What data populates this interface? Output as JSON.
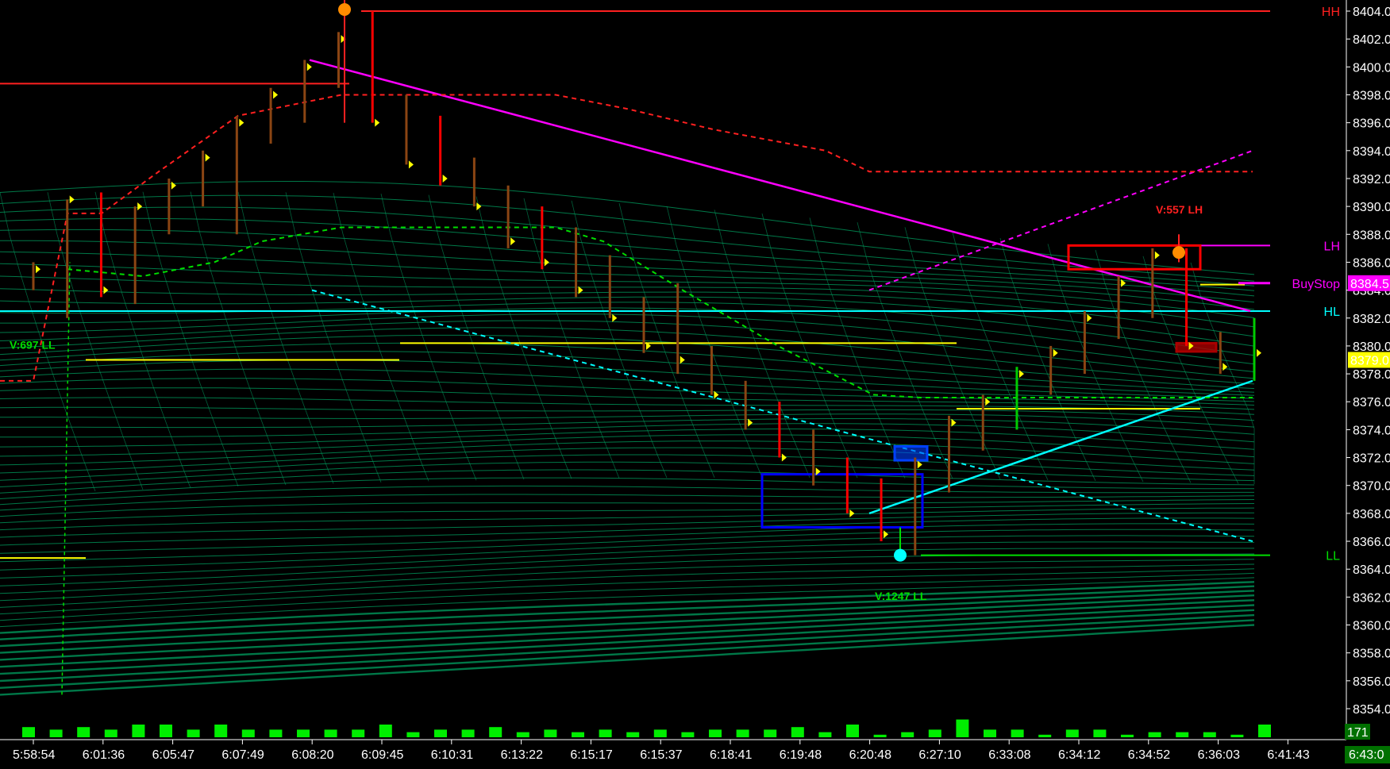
{
  "chart_data": {
    "type": "candlestick",
    "ylim": [
      8352,
      8405
    ],
    "y_ticks": [
      8404,
      8402,
      8400,
      8398,
      8396,
      8394,
      8392,
      8390,
      8388,
      8386,
      8384,
      8382,
      8380,
      8378,
      8376,
      8374,
      8372,
      8370,
      8368,
      8366,
      8364,
      8362,
      8360,
      8358,
      8356,
      8354
    ],
    "y_tick_labels": [
      "8404.0",
      "8402.0",
      "8400.0",
      "8398.0",
      "8396.0",
      "8394.0",
      "8392.0",
      "8390.0",
      "8388.0",
      "8386.0",
      "8384.0",
      "8382.0",
      "8380.0",
      "8378.0",
      "8376.0",
      "8374.0",
      "8372.0",
      "8370.0",
      "8368.0",
      "8366.0",
      "8364.0",
      "8362.0",
      "8360.0",
      "8358.0",
      "8356.0",
      "8354.0"
    ],
    "x_tick_labels": [
      "5:58:54",
      "6:01:36",
      "6:05:47",
      "6:07:49",
      "6:08:20",
      "6:09:45",
      "6:10:31",
      "6:13:22",
      "6:15:17",
      "6:15:37",
      "6:18:41",
      "6:19:48",
      "6:20:48",
      "6:27:10",
      "6:33:08",
      "6:34:12",
      "6:34:52",
      "6:36:03",
      "6:41:43"
    ],
    "bars": [
      {
        "o": 8385,
        "h": 8386,
        "l": 8384,
        "c": 8385.5,
        "color": "#8b4513"
      },
      {
        "o": 8387,
        "h": 8390.5,
        "l": 8382,
        "c": 8390.5,
        "color": "#8b4513"
      },
      {
        "o": 8388,
        "h": 8391,
        "l": 8383.5,
        "c": 8384,
        "color": "#ff0000"
      },
      {
        "o": 8386,
        "h": 8390,
        "l": 8383,
        "c": 8390,
        "color": "#8b4513"
      },
      {
        "o": 8388.5,
        "h": 8392,
        "l": 8388,
        "c": 8391.5,
        "color": "#8b4513"
      },
      {
        "o": 8391,
        "h": 8394,
        "l": 8390,
        "c": 8393.5,
        "color": "#8b4513"
      },
      {
        "o": 8392,
        "h": 8396.5,
        "l": 8388,
        "c": 8396,
        "color": "#8b4513"
      },
      {
        "o": 8395,
        "h": 8398.5,
        "l": 8394.5,
        "c": 8398,
        "color": "#8b4513"
      },
      {
        "o": 8397,
        "h": 8400.5,
        "l": 8396,
        "c": 8400,
        "color": "#8b4513"
      },
      {
        "o": 8399,
        "h": 8402.5,
        "l": 8398.5,
        "c": 8402,
        "color": "#8b4513"
      },
      {
        "o": 8400,
        "h": 8404,
        "l": 8396,
        "c": 8396,
        "color": "#ff0000"
      },
      {
        "o": 8397,
        "h": 8398,
        "l": 8393,
        "c": 8393,
        "color": "#8b4513"
      },
      {
        "o": 8396,
        "h": 8396.5,
        "l": 8391.5,
        "c": 8392,
        "color": "#ff0000"
      },
      {
        "o": 8393,
        "h": 8393.5,
        "l": 8390,
        "c": 8390,
        "color": "#8b4513"
      },
      {
        "o": 8390,
        "h": 8391.5,
        "l": 8387,
        "c": 8387.5,
        "color": "#8b4513"
      },
      {
        "o": 8390,
        "h": 8390,
        "l": 8385.5,
        "c": 8386,
        "color": "#ff0000"
      },
      {
        "o": 8388,
        "h": 8388.5,
        "l": 8383.5,
        "c": 8384,
        "color": "#8b4513"
      },
      {
        "o": 8386,
        "h": 8386.5,
        "l": 8382,
        "c": 8382,
        "color": "#8b4513"
      },
      {
        "o": 8383,
        "h": 8383.5,
        "l": 8379.5,
        "c": 8380,
        "color": "#8b4513"
      },
      {
        "o": 8382,
        "h": 8384.5,
        "l": 8378,
        "c": 8379,
        "color": "#8b4513"
      },
      {
        "o": 8380,
        "h": 8380,
        "l": 8376.5,
        "c": 8376.5,
        "color": "#8b4513"
      },
      {
        "o": 8377,
        "h": 8377.5,
        "l": 8374,
        "c": 8374.5,
        "color": "#8b4513"
      },
      {
        "o": 8376,
        "h": 8376,
        "l": 8372,
        "c": 8372,
        "color": "#ff0000"
      },
      {
        "o": 8374,
        "h": 8374,
        "l": 8370,
        "c": 8371,
        "color": "#8b4513"
      },
      {
        "o": 8372,
        "h": 8372,
        "l": 8368,
        "c": 8368,
        "color": "#ff0000"
      },
      {
        "o": 8370,
        "h": 8370.5,
        "l": 8366,
        "c": 8366.5,
        "color": "#ff0000"
      },
      {
        "o": 8368,
        "h": 8372,
        "l": 8365,
        "c": 8371.5,
        "color": "#8b4513"
      },
      {
        "o": 8370,
        "h": 8375,
        "l": 8369.5,
        "c": 8374.5,
        "color": "#8b4513"
      },
      {
        "o": 8373,
        "h": 8376.5,
        "l": 8372.5,
        "c": 8376,
        "color": "#8b4513"
      },
      {
        "o": 8374.5,
        "h": 8378.5,
        "l": 8374,
        "c": 8378,
        "color": "#00cc00"
      },
      {
        "o": 8377,
        "h": 8380,
        "l": 8376.5,
        "c": 8379.5,
        "color": "#8b4513"
      },
      {
        "o": 8379,
        "h": 8382.5,
        "l": 8378,
        "c": 8382,
        "color": "#8b4513"
      },
      {
        "o": 8381,
        "h": 8385,
        "l": 8380.5,
        "c": 8384.5,
        "color": "#8b4513"
      },
      {
        "o": 8383,
        "h": 8387,
        "l": 8382,
        "c": 8386.5,
        "color": "#8b4513"
      },
      {
        "o": 8386,
        "h": 8387,
        "l": 8380,
        "c": 8380,
        "color": "#ff0000"
      },
      {
        "o": 8380,
        "h": 8381,
        "l": 8378,
        "c": 8378.5,
        "color": "#8b4513"
      },
      {
        "o": 8377.5,
        "h": 8382,
        "l": 8377.5,
        "c": 8379.5,
        "color": "#00cc00"
      }
    ],
    "volume": [
      4,
      3,
      4,
      3,
      5,
      5,
      3,
      5,
      3,
      3,
      3,
      3,
      3,
      5,
      2,
      3,
      3,
      4,
      2,
      3,
      2,
      3,
      2,
      3,
      2,
      3,
      3,
      3,
      4,
      2,
      5,
      1,
      2,
      3,
      7,
      3,
      3,
      1,
      3,
      3,
      1,
      2,
      2,
      2,
      1,
      5
    ],
    "levels": [
      {
        "label": "HH",
        "price": 8404,
        "color": "#ff2020"
      },
      {
        "label": "LH",
        "price": 8387.2,
        "color": "#ff00ff"
      },
      {
        "label": "BuyStop",
        "price": 8384.5,
        "color": "#ff00ff"
      },
      {
        "label": "HL",
        "price": 8382.5,
        "color": "#00ffff"
      },
      {
        "label": "LL",
        "price": 8365,
        "color": "#00dd00"
      }
    ],
    "price_tags": [
      {
        "text": "8384.5",
        "price": 8384.5,
        "bg": "#ff00ff",
        "fg": "#ffffff"
      },
      {
        "text": "8379.0",
        "price": 8379,
        "bg": "#ffff00",
        "fg": "#000000"
      }
    ],
    "annotations": [
      {
        "text": "V:697 LL",
        "color": "#00dd00"
      },
      {
        "text": "V:1247 LL",
        "color": "#00dd00"
      },
      {
        "text": "V:557 LH",
        "color": "#ff2020"
      }
    ],
    "volume_readout": "171",
    "bottom_right_time": "6:43:0",
    "colors": {
      "background": "#000000",
      "ribbon": "#00a060",
      "up": "#00cc00",
      "down": "#ff0000",
      "neutral": "#8b4513",
      "volume": "#00ee00"
    }
  }
}
